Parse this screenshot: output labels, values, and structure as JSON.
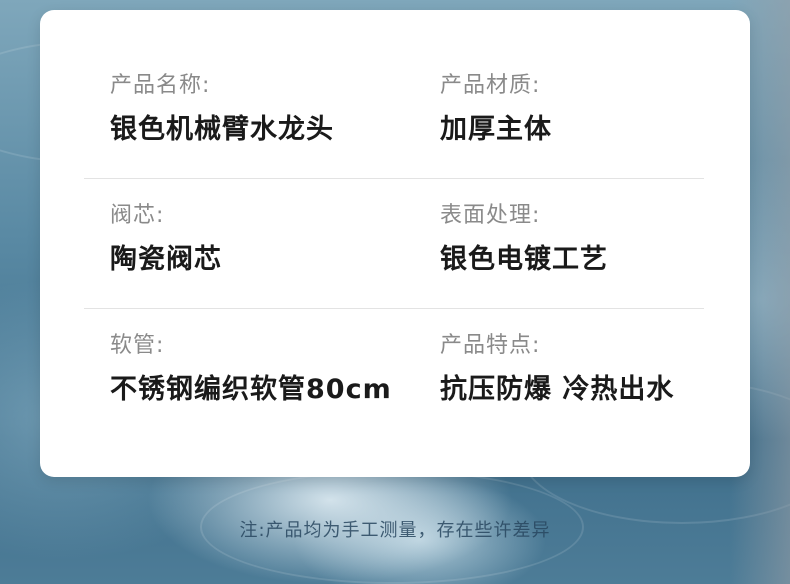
{
  "specs": [
    {
      "label": "产品名称:",
      "value": "银色机械臂水龙头"
    },
    {
      "label": "产品材质:",
      "value": "加厚主体"
    },
    {
      "label": "阀芯:",
      "value": "陶瓷阀芯"
    },
    {
      "label": "表面处理:",
      "value": "银色电镀工艺"
    },
    {
      "label": "软管:",
      "value": "不锈钢编织软管80cm"
    },
    {
      "label": "产品特点:",
      "value": "抗压防爆 冷热出水"
    }
  ],
  "footnote": "注:产品均为手工测量，存在些许差异",
  "colors": {
    "card": "#ffffff",
    "label": "#8a8a8a",
    "value": "#1a1a1a",
    "water": "#5a8aa4"
  }
}
